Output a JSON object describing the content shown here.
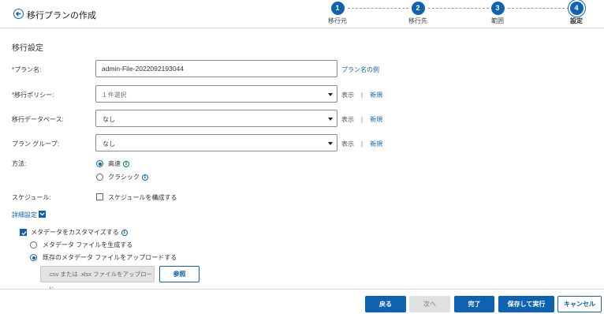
{
  "header": {
    "title": "移行プランの作成"
  },
  "steps": [
    {
      "number": "1",
      "label": "移行元"
    },
    {
      "number": "2",
      "label": "移行先"
    },
    {
      "number": "3",
      "label": "範囲"
    },
    {
      "number": "4",
      "label": "設定",
      "current": true
    }
  ],
  "section": {
    "title": "移行設定"
  },
  "form": {
    "required_mark": "*",
    "plan_name": {
      "label": "プラン名:",
      "value": "admin-File-2022092193044",
      "example_link": "プラン名の例"
    },
    "policy": {
      "label": "移行ポリシー:",
      "value": "1 件選択",
      "view": "表示",
      "new": "新規"
    },
    "database": {
      "label": "移行データベース:",
      "value": "なし",
      "view": "表示",
      "new": "新規"
    },
    "plan_group": {
      "label": "プラン グループ:",
      "value": "なし",
      "view": "表示",
      "new": "新規"
    },
    "separator": "|",
    "method": {
      "label": "方法:",
      "options": [
        {
          "label": "高速",
          "checked": true
        },
        {
          "label": "クラシック",
          "checked": false
        }
      ]
    },
    "schedule": {
      "label": "スケジュール:",
      "checkbox_label": "スケジュールを構成する",
      "checked": false
    }
  },
  "advanced": {
    "toggle_label": "詳細設定",
    "customize_metadata": {
      "label": "メタデータをカスタマイズする",
      "checked": true
    },
    "metadata_options": [
      {
        "label": "メタデータ ファイルを生成する",
        "checked": false
      },
      {
        "label": "既存のメタデータ ファイルをアップロードする",
        "checked": true
      }
    ],
    "file_placeholder": ".csv または .xlsx ファイルをアップロード",
    "browse_label": "参照"
  },
  "info_icon_glyph": "i",
  "footer": {
    "back": "戻る",
    "next": "次へ",
    "finish": "完了",
    "save_run": "保存して実行",
    "cancel": "キャンセル"
  },
  "colors": {
    "accent": "#0f62b0",
    "required": "#d0021b"
  }
}
